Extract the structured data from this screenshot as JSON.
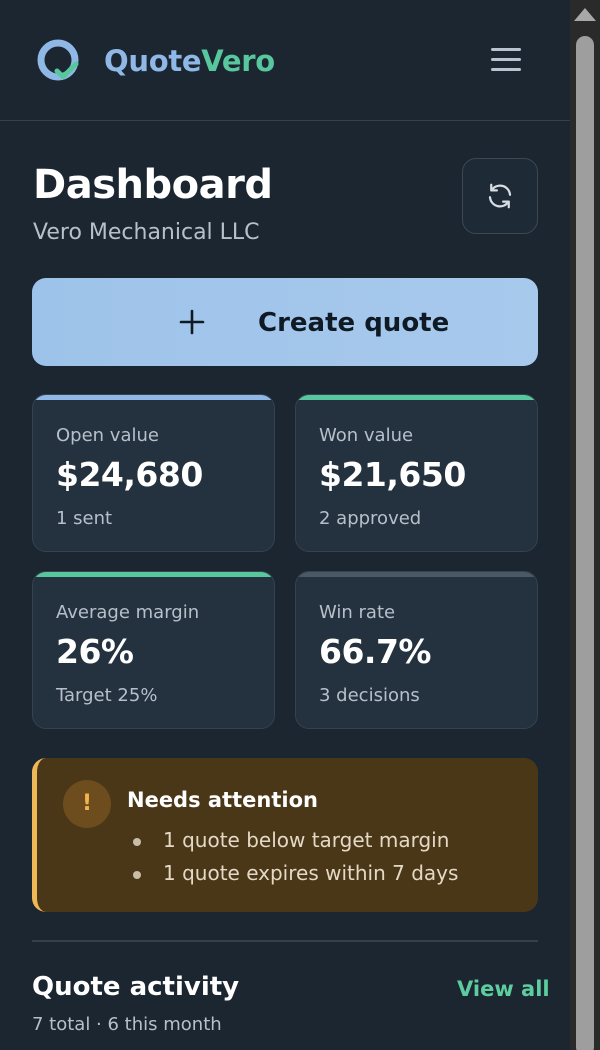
{
  "brand": {
    "part1": "Quote",
    "part2": "Vero"
  },
  "page": {
    "title": "Dashboard",
    "company": "Vero Mechanical LLC"
  },
  "actions": {
    "create_label": "Create quote"
  },
  "stats": [
    {
      "label": "Open value",
      "value": "$24,680",
      "sub": "1 sent",
      "accent": "#8fb8e6"
    },
    {
      "label": "Won value",
      "value": "$21,650",
      "sub": "2 approved",
      "accent": "#58c79d"
    },
    {
      "label": "Average margin",
      "value": "26%",
      "sub": "Target 25%",
      "accent": "#58c79d"
    },
    {
      "label": "Win rate",
      "value": "66.7%",
      "sub": "3 decisions",
      "accent": "#4b5966"
    }
  ],
  "attention": {
    "title": "Needs attention",
    "icon": "!",
    "items": [
      "1 quote below target margin",
      "1 quote expires within 7 days"
    ]
  },
  "activity": {
    "title": "Quote activity",
    "view_all": "View all",
    "summary": "7 total · 6 this month"
  },
  "icons": {
    "logo": "logo-icon",
    "menu": "menu-icon",
    "refresh": "refresh-icon",
    "plus": "plus-icon",
    "warning": "warning-icon"
  },
  "colors": {
    "accent_blue": "#8fb8e6",
    "accent_green": "#58c79d",
    "warning": "#f0b758",
    "background": "#1b2631"
  }
}
